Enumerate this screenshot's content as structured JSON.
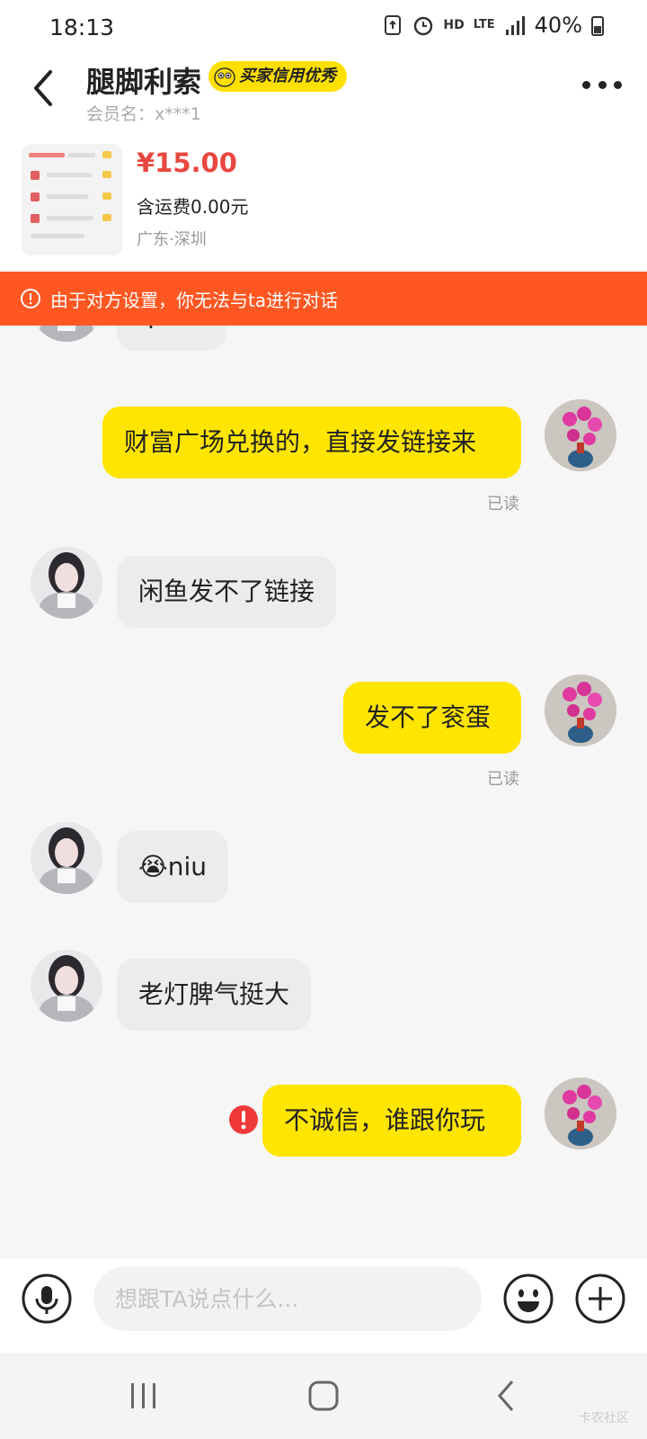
{
  "status_bar": {
    "time": "18:13",
    "hd": "HD",
    "lte": "LTE",
    "battery": "40%"
  },
  "header": {
    "title": "腿脚利索",
    "badge": "买家信用优秀",
    "member": "会员名：x***1"
  },
  "product": {
    "price": "¥15.00",
    "shipping": "含运费0.00元",
    "location": "广东·深圳"
  },
  "alert": {
    "text": "由于对方设置，你无法与ta进行对话"
  },
  "chat": {
    "partial_message": "q包行",
    "messages": [
      {
        "from": "self",
        "text": "财富广场兑换的，直接发链接来",
        "status": "已读"
      },
      {
        "from": "other",
        "text": "闲鱼发不了链接"
      },
      {
        "from": "self",
        "text": "发不了衮蛋",
        "status": "已读"
      },
      {
        "from": "other",
        "emoji": "😭",
        "text": "niu"
      },
      {
        "from": "other",
        "text": "老灯脾气挺大"
      },
      {
        "from": "self",
        "text": "不诚信，谁跟你玩",
        "failed": true
      }
    ]
  },
  "input_bar": {
    "placeholder": "想跟TA说点什么..."
  },
  "icons": {
    "accent": "#ffe500",
    "alert_color": "#ff5722",
    "price_color": "#e8473f"
  },
  "nav": {
    "watermark": "卡农社区"
  }
}
